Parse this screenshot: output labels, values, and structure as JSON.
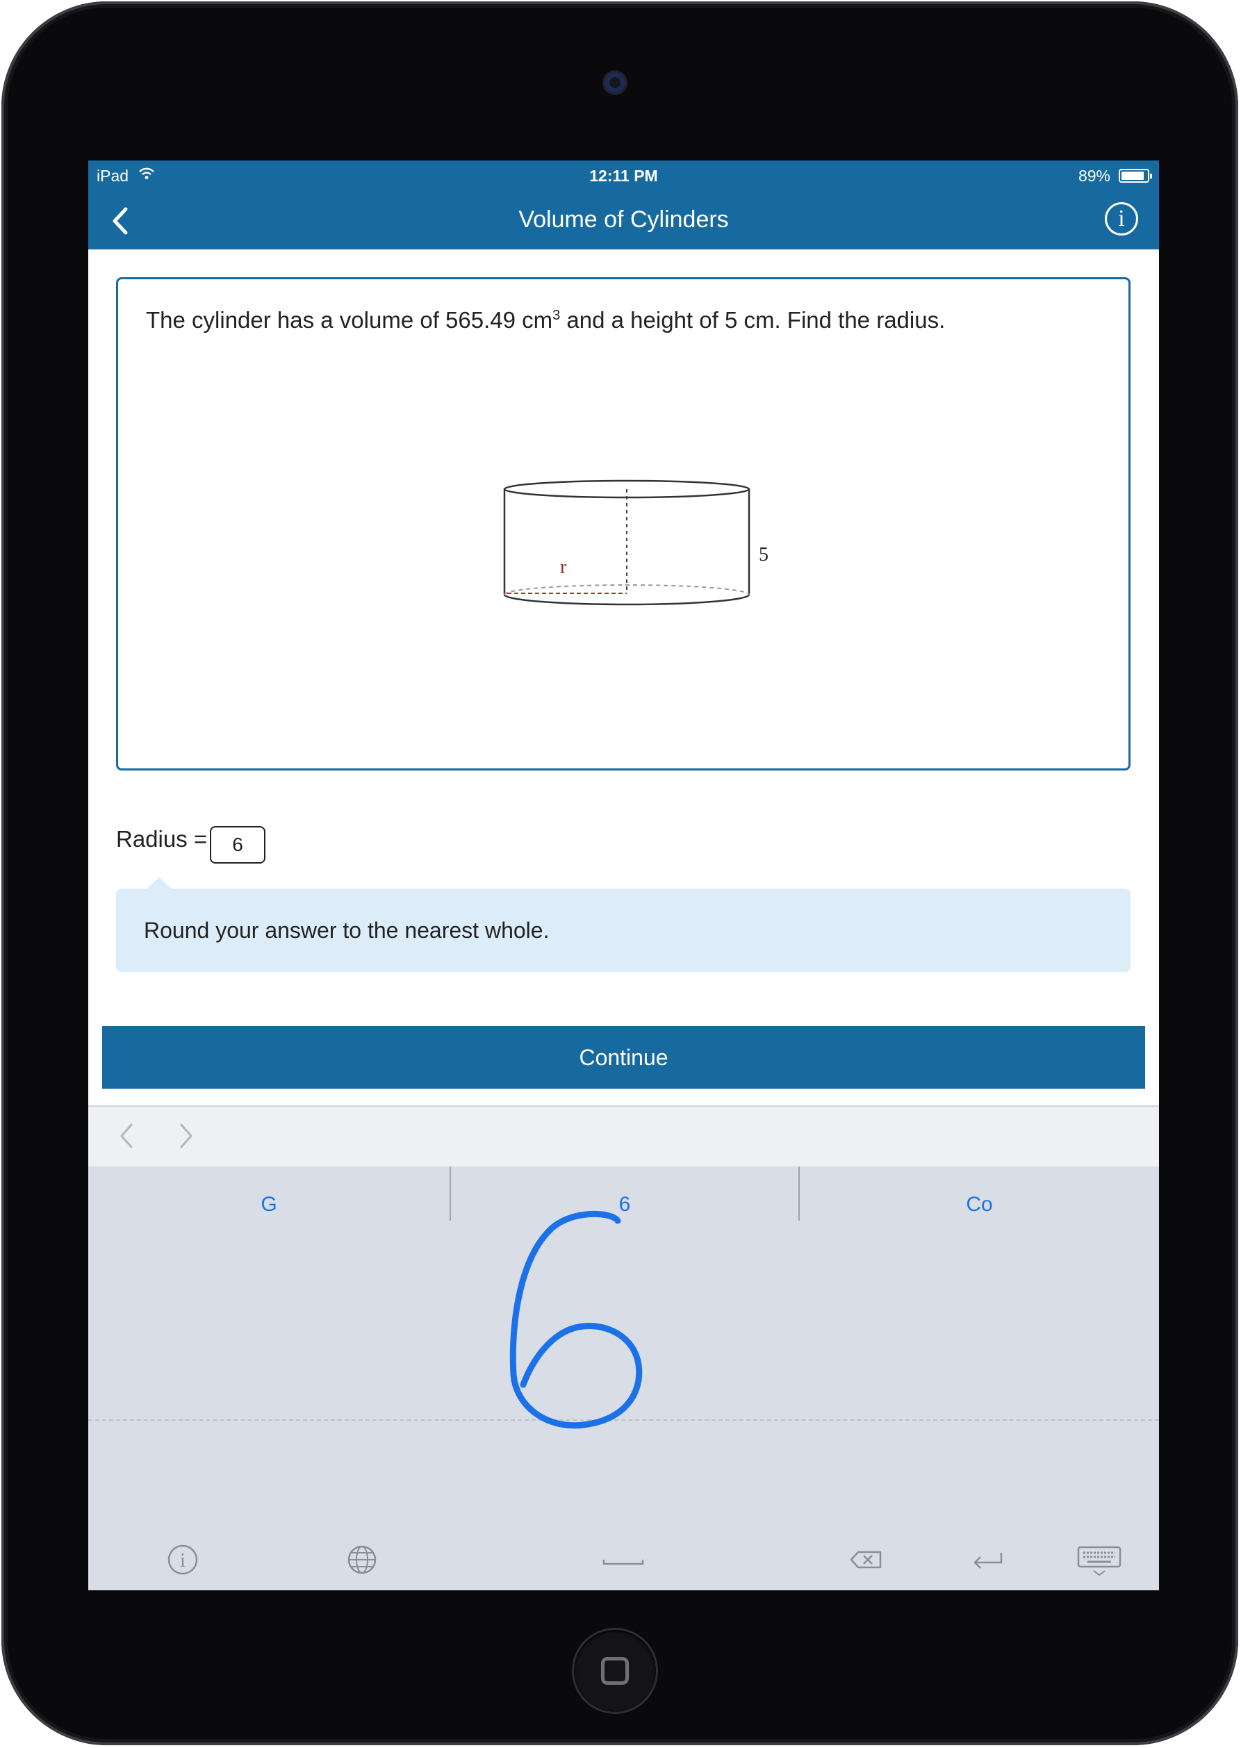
{
  "status_bar": {
    "carrier": "iPad",
    "time": "12:11 PM",
    "battery": "89%",
    "battery_level": 0.89
  },
  "nav_bar": {
    "title": "Volume of Cylinders",
    "info_glyph": "i",
    "back_icon": "chevron-left-icon"
  },
  "question": {
    "text_before": "The cylinder has a volume of 565.49 cm",
    "superscript": "3",
    "text_after": " and a height of 5 cm. Find the radius.",
    "figure": {
      "radius_label": "r",
      "height_label": "5"
    }
  },
  "answer": {
    "label": "Radius =",
    "value": "6"
  },
  "hint": {
    "text": "Round your answer to the nearest whole."
  },
  "continue_label": "Continue",
  "keyboard": {
    "candidates": [
      "G",
      "6",
      "Co"
    ],
    "handwriting_glyph": "6",
    "bottom_icons": [
      "info-icon",
      "globe-icon",
      "space-icon",
      "delete-icon",
      "return-icon",
      "keyboard-dismiss-icon"
    ]
  },
  "colors": {
    "brand": "#176aa0",
    "hint_bg": "#dcedf9",
    "keyboard_bg": "#d9dde5",
    "candidate_text": "#1b72e8",
    "ink": "#1b72e8",
    "radius_line": "#b03030"
  }
}
